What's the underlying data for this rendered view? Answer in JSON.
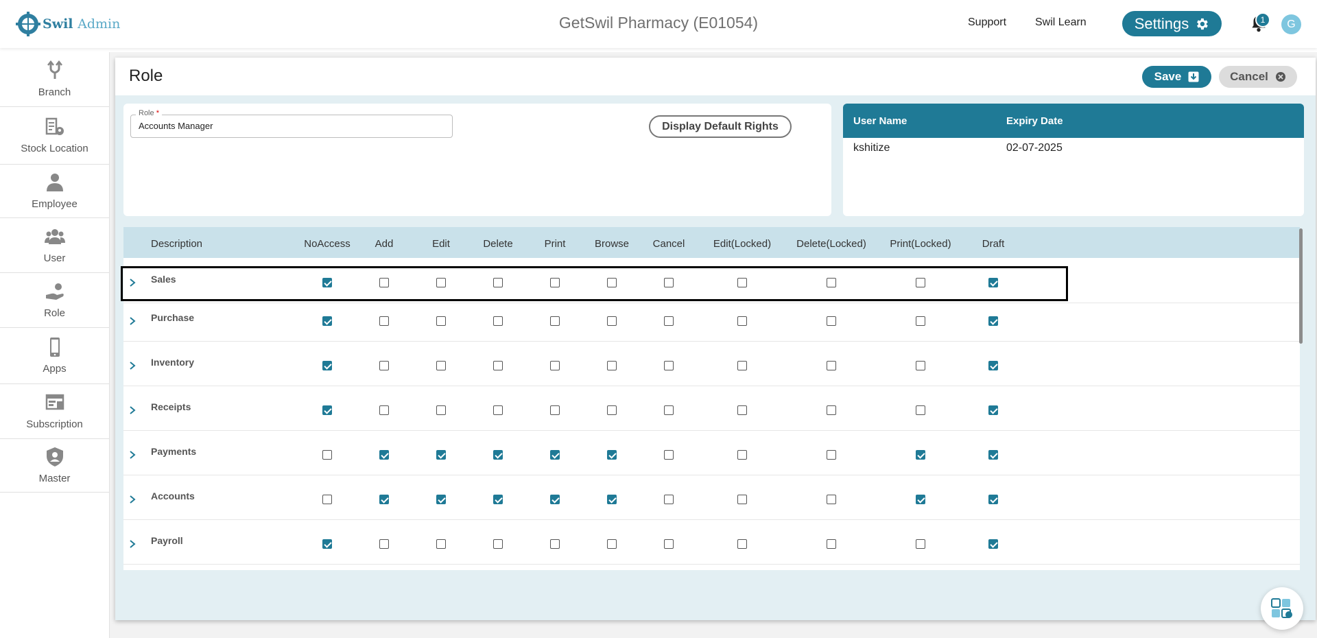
{
  "header": {
    "logo_text": "Swil",
    "logo_text_suffix": "Admin",
    "org_title": "GetSwil Pharmacy (E01054)",
    "links": [
      "Support",
      "Swil Learn"
    ],
    "settings_label": "Settings",
    "notification_count": "1",
    "avatar_initial": "G"
  },
  "sidebar": {
    "items": [
      {
        "label": "Branch",
        "icon": "branch-icon"
      },
      {
        "label": "Stock Location",
        "icon": "stock-location-icon"
      },
      {
        "label": "Employee",
        "icon": "employee-icon"
      },
      {
        "label": "User",
        "icon": "user-icon"
      },
      {
        "label": "Role",
        "icon": "role-icon"
      },
      {
        "label": "Apps",
        "icon": "phone-icon"
      },
      {
        "label": "Subscription",
        "icon": "subscription-icon"
      },
      {
        "label": "Master",
        "icon": "master-shield-icon"
      }
    ]
  },
  "page": {
    "title": "Role",
    "save_label": "Save",
    "cancel_label": "Cancel"
  },
  "role_form": {
    "label": "Role",
    "required_mark": "*",
    "value": "Accounts Manager",
    "default_rights_label": "Display Default Rights"
  },
  "user_table": {
    "headers": [
      "User Name",
      "Expiry Date"
    ],
    "rows": [
      [
        "kshitize",
        "02-07-2025"
      ]
    ]
  },
  "rights": {
    "description_header": "Description",
    "columns": [
      "NoAccess",
      "Add",
      "Edit",
      "Delete",
      "Print",
      "Browse",
      "Cancel",
      "Edit(Locked)",
      "Delete(Locked)",
      "Print(Locked)",
      "Draft"
    ],
    "rows": [
      {
        "name": "Sales",
        "checks": [
          1,
          0,
          0,
          0,
          0,
          0,
          0,
          0,
          0,
          0,
          1
        ]
      },
      {
        "name": "Purchase",
        "checks": [
          1,
          0,
          0,
          0,
          0,
          0,
          0,
          0,
          0,
          0,
          1
        ]
      },
      {
        "name": "Inventory",
        "checks": [
          1,
          0,
          0,
          0,
          0,
          0,
          0,
          0,
          0,
          0,
          1
        ]
      },
      {
        "name": "Receipts",
        "checks": [
          1,
          0,
          0,
          0,
          0,
          0,
          0,
          0,
          0,
          0,
          1
        ]
      },
      {
        "name": "Payments",
        "checks": [
          0,
          1,
          1,
          1,
          1,
          1,
          0,
          0,
          0,
          1,
          1
        ]
      },
      {
        "name": "Accounts",
        "checks": [
          0,
          1,
          1,
          1,
          1,
          1,
          0,
          0,
          0,
          1,
          1
        ]
      },
      {
        "name": "Payroll",
        "checks": [
          1,
          0,
          0,
          0,
          0,
          0,
          0,
          0,
          0,
          0,
          1
        ]
      }
    ],
    "highlighted_row": "Sales"
  },
  "colors": {
    "accent": "#1f7a96",
    "header_bg": "#c9e1ea",
    "panel_bg": "#e3eff3"
  }
}
